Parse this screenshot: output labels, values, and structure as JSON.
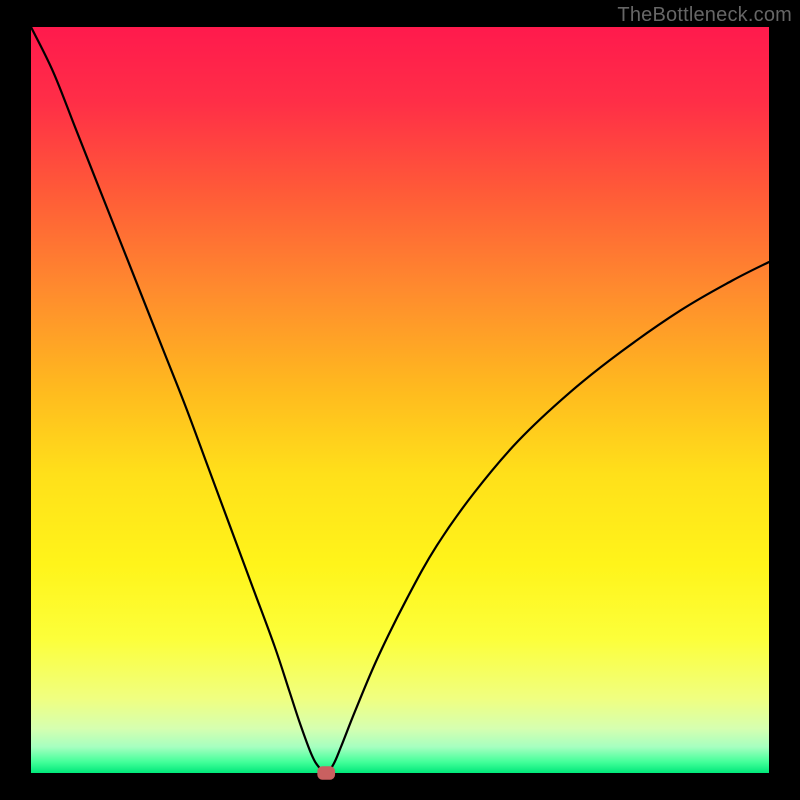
{
  "watermark": "TheBottleneck.com",
  "plot": {
    "inner_x": 31,
    "inner_y": 27,
    "inner_w": 738,
    "inner_h": 746,
    "gradient_stops": [
      {
        "offset": 0.0,
        "color": "#ff1a4d"
      },
      {
        "offset": 0.1,
        "color": "#ff2e47"
      },
      {
        "offset": 0.22,
        "color": "#ff5a38"
      },
      {
        "offset": 0.35,
        "color": "#ff8a2e"
      },
      {
        "offset": 0.48,
        "color": "#ffb81f"
      },
      {
        "offset": 0.6,
        "color": "#ffe01a"
      },
      {
        "offset": 0.72,
        "color": "#fff41a"
      },
      {
        "offset": 0.82,
        "color": "#fcff3a"
      },
      {
        "offset": 0.9,
        "color": "#f0ff80"
      },
      {
        "offset": 0.94,
        "color": "#d6ffb0"
      },
      {
        "offset": 0.965,
        "color": "#a6ffc0"
      },
      {
        "offset": 0.985,
        "color": "#44ff9a"
      },
      {
        "offset": 1.0,
        "color": "#00e87a"
      }
    ]
  },
  "chart_data": {
    "type": "line",
    "title": "",
    "xlabel": "",
    "ylabel": "",
    "x_range": [
      0,
      100
    ],
    "y_range": [
      0,
      100
    ],
    "series": [
      {
        "name": "bottleneck-curve",
        "x": [
          0.0,
          3.0,
          6.0,
          9.0,
          12.0,
          15.0,
          18.0,
          21.0,
          24.0,
          27.0,
          30.0,
          33.0,
          35.0,
          36.5,
          38.0,
          39.0,
          40.0,
          41.0,
          42.0,
          44.0,
          47.0,
          51.0,
          55.0,
          60.0,
          66.0,
          73.0,
          80.0,
          88.0,
          95.0,
          100.0
        ],
        "y": [
          100.0,
          94.0,
          86.5,
          79.0,
          71.5,
          64.0,
          56.5,
          49.0,
          41.0,
          33.0,
          25.0,
          17.0,
          11.0,
          6.5,
          2.5,
          0.8,
          0.0,
          1.2,
          3.5,
          8.5,
          15.5,
          23.5,
          30.5,
          37.5,
          44.5,
          51.0,
          56.5,
          62.0,
          66.0,
          68.5
        ]
      }
    ],
    "marker": {
      "x": 40.0,
      "y": 0.0,
      "rx": 1.2,
      "ry": 0.9
    },
    "annotations": []
  }
}
